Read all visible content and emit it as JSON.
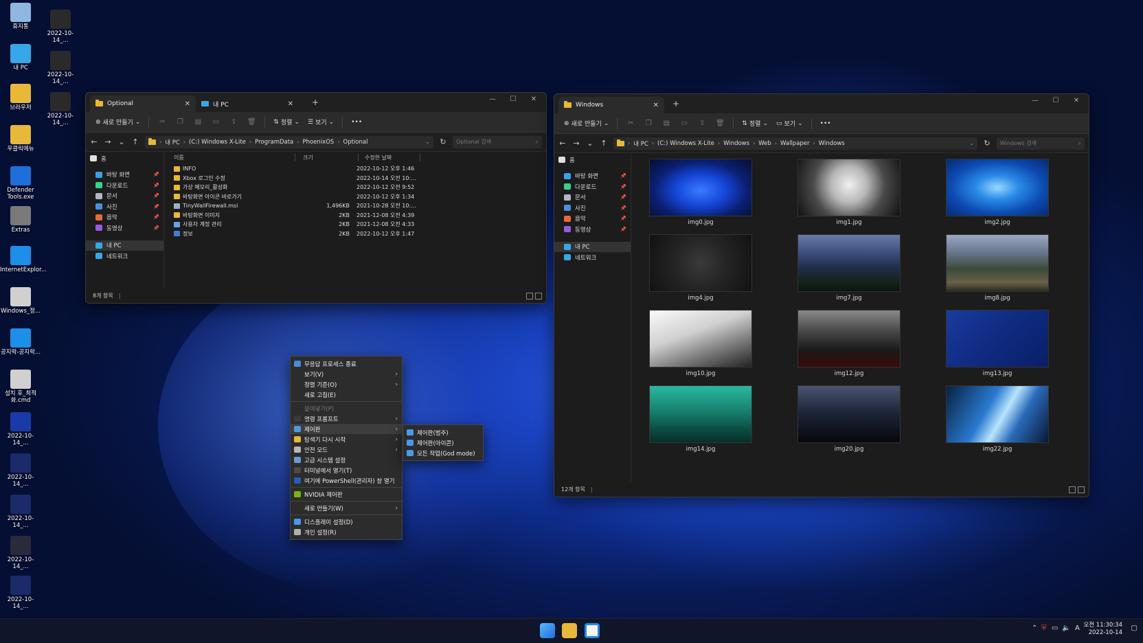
{
  "desktop": {
    "icons": [
      {
        "label": "휴지통",
        "icon": "recycle-bin-icon",
        "color": "#8fb7e0"
      },
      {
        "label": "2022-10-14_...",
        "icon": "screenshot-icon",
        "color": "#2a2a2a"
      },
      {
        "label": "내 PC",
        "icon": "pc-icon",
        "color": "#36a8e8"
      },
      {
        "label": "2022-10-14_...",
        "icon": "screenshot-icon",
        "color": "#2a2a2a"
      },
      {
        "label": "브라우저",
        "icon": "folder-icon",
        "color": "#e8b838"
      },
      {
        "label": "2022-10-14_...",
        "icon": "screenshot-icon",
        "color": "#2a2a2a"
      },
      {
        "label": "우클릭메뉴",
        "icon": "folder-icon",
        "color": "#e8b838"
      },
      {
        "label": "Defender Tools.exe",
        "icon": "shield-icon",
        "color": "#1e6fd9"
      },
      {
        "label": "Extras",
        "icon": "archive-icon",
        "color": "#7a7a7a"
      },
      {
        "label": "InternetExplor...",
        "icon": "ie-icon",
        "color": "#1e8fe8"
      },
      {
        "label": "Windows_정...",
        "icon": "cmd-gear-icon",
        "color": "#d0d0d0"
      },
      {
        "label": "공지락-공지락...",
        "icon": "ie-icon",
        "color": "#1e8fe8"
      },
      {
        "label": "설치 후_최적화.cmd",
        "icon": "cmd-gear-icon",
        "color": "#d0d0d0"
      },
      {
        "label": "2022-10-14_...",
        "icon": "screenshot-icon",
        "color": "#1a3aa8"
      },
      {
        "label": "2022-10-14_...",
        "icon": "screenshot-icon",
        "color": "#1a2a6a"
      },
      {
        "label": "2022-10-14_...",
        "icon": "screenshot-icon",
        "color": "#1a2a6a"
      },
      {
        "label": "2022-10-14_...",
        "icon": "screenshot-icon",
        "color": "#2a2a3a"
      },
      {
        "label": "2022-10-14_...",
        "icon": "screenshot-icon",
        "color": "#1a2a6a"
      }
    ]
  },
  "win1": {
    "tabs": [
      {
        "label": "Optional"
      },
      {
        "label": "내 PC"
      }
    ],
    "toolbar": {
      "new": "새로 만들기",
      "sort": "정렬",
      "view": "보기"
    },
    "address": [
      "내 PC",
      "(C:) Windows X-Lite",
      "ProgramData",
      "PhoenixOS",
      "Optional"
    ],
    "search_placeholder": "Optional 검색",
    "sidebar": [
      {
        "label": "홈",
        "color": "#e0e0e0"
      },
      {
        "label": "바탕 화면",
        "color": "#3aa0e8",
        "pin": true
      },
      {
        "label": "다운로드",
        "color": "#3ad08a",
        "pin": true
      },
      {
        "label": "문서",
        "color": "#b0b8c8",
        "pin": true
      },
      {
        "label": "사진",
        "color": "#4a90e2",
        "pin": true
      },
      {
        "label": "음악",
        "color": "#e86a3a",
        "pin": true
      },
      {
        "label": "동영상",
        "color": "#9a5ae0",
        "pin": true
      },
      {
        "label": "내 PC",
        "color": "#36a8e8"
      },
      {
        "label": "네트워크",
        "color": "#36a8e8"
      }
    ],
    "columns": {
      "name": "이름",
      "size": "크기",
      "date": "수정한 날짜"
    },
    "files": [
      {
        "name": "INFO",
        "size": "",
        "date": "2022-10-12 오후 1:46",
        "color": "#e8b838"
      },
      {
        "name": "Xbox 로그인 수정",
        "size": "",
        "date": "2022-10-14 오전 10:...",
        "color": "#e8b838"
      },
      {
        "name": "가상 메모리_활성화",
        "size": "",
        "date": "2022-10-12 오전 9:52",
        "color": "#e8b838"
      },
      {
        "name": "바탕화면 아이콘 바로가기",
        "size": "",
        "date": "2022-10-12 오후 1:34",
        "color": "#e8b838"
      },
      {
        "name": "TinyWallFirewall.msi",
        "size": "1,496KB",
        "date": "2021-10-28 오전 10:...",
        "color": "#9fb0c0"
      },
      {
        "name": "바탕화면 이미지",
        "size": "2KB",
        "date": "2021-12-08 오전 4:39",
        "color": "#e8b838"
      },
      {
        "name": "사용자 계정 관리",
        "size": "2KB",
        "date": "2021-12-08 오전 4:33",
        "color": "#6fa0e0"
      },
      {
        "name": "정보",
        "size": "2KB",
        "date": "2022-10-12 오후 1:47",
        "color": "#4a7ad0"
      }
    ],
    "status": "8개 항목"
  },
  "win2": {
    "tabs": [
      {
        "label": "Windows"
      }
    ],
    "toolbar": {
      "new": "새로 만들기",
      "sort": "정렬",
      "view": "보기"
    },
    "address": [
      "내 PC",
      "(C:) Windows X-Lite",
      "Windows",
      "Web",
      "Wallpaper",
      "Windows"
    ],
    "search_placeholder": "Windows 검색",
    "sidebar": [
      {
        "label": "홈",
        "color": "#e0e0e0"
      },
      {
        "label": "바탕 화면",
        "color": "#3aa0e8",
        "pin": true
      },
      {
        "label": "다운로드",
        "color": "#3ad08a",
        "pin": true
      },
      {
        "label": "문서",
        "color": "#b0b8c8",
        "pin": true
      },
      {
        "label": "사진",
        "color": "#4a90e2",
        "pin": true
      },
      {
        "label": "음악",
        "color": "#e86a3a",
        "pin": true
      },
      {
        "label": "동영상",
        "color": "#9a5ae0",
        "pin": true
      },
      {
        "label": "내 PC",
        "color": "#36a8e8"
      },
      {
        "label": "네트워크",
        "color": "#36a8e8"
      }
    ],
    "images": [
      {
        "name": "img0.jpg",
        "bg": "radial-gradient(ellipse at 50% 55%,#3a7cff 0%,#1546d8 35%,#0a1f70 65%,#060e30 100%)"
      },
      {
        "name": "img1.jpg",
        "bg": "radial-gradient(circle at 50% 45%,#f0f0f0 0%,#b8b8b8 30%,#4a4a4a 60%,#111 100%)"
      },
      {
        "name": "img2.jpg",
        "bg": "radial-gradient(ellipse at 50% 50%,#9ad8ff 0%,#2a8ae8 30%,#0c4ab0 65%,#062a70 100%)"
      },
      {
        "name": "img4.jpg",
        "bg": "radial-gradient(circle at 50% 50%,#3a3a3a 0%,#242424 45%,#121212 100%)"
      },
      {
        "name": "img7.jpg",
        "bg": "linear-gradient(180deg,#6a7aa8 0%,#3a4a78 35%,#1e2c48 60%,#142218 85%,#0c1410 100%)"
      },
      {
        "name": "img8.jpg",
        "bg": "linear-gradient(180deg,#9aa8c0 0%,#6a7890 30%,#3a4a38 60%,#6a6048 85%,#2a2a20 100%)"
      },
      {
        "name": "img10.jpg",
        "bg": "linear-gradient(160deg,#fafafa 0%,#d0d0d0 40%,#777 70%,#222 100%)"
      },
      {
        "name": "img12.jpg",
        "bg": "linear-gradient(180deg,#8a8a8a 0%,#4a4a4a 35%,#1a1a1a 70%,#3a0a0a 100%)"
      },
      {
        "name": "img13.jpg",
        "bg": "linear-gradient(135deg,#1a3aa0 0%,#0f2a80 50%,#0a1f68 100%)"
      },
      {
        "name": "img14.jpg",
        "bg": "linear-gradient(180deg,#2ab8a0 0%,#16806e 45%,#0c5046 75%,#063028 100%)"
      },
      {
        "name": "img20.jpg",
        "bg": "linear-gradient(180deg,#4a5570 0%,#1e2638 45%,#0e121c 80%,#06080c 100%)"
      },
      {
        "name": "img22.jpg",
        "bg": "linear-gradient(120deg,#082040 0%,#2a7ad0 40%,#b8e4ff 55%,#2a6ab8 70%,#081838 100%)"
      }
    ],
    "status": "12개 항목"
  },
  "context_menu": {
    "items": [
      {
        "label": "무응답 프로세스 종료",
        "icon": "#4a8ad8"
      },
      {
        "label": "보기(V)",
        "arrow": true
      },
      {
        "label": "정렬 기준(O)",
        "arrow": true
      },
      {
        "label": "새로 고침(E)"
      },
      {
        "sep": true
      },
      {
        "label": "붙여넣기(P)",
        "disabled": true
      },
      {
        "label": "명령 프롬프트",
        "icon": "#3a3a3a",
        "arrow": true
      },
      {
        "label": "제어판",
        "icon": "#4a9ae8",
        "arrow": true,
        "highlight": true
      },
      {
        "label": "탐색기 다시 시작",
        "icon": "#e8b838",
        "arrow": true
      },
      {
        "label": "안전 모드",
        "icon": "#b8b8b8",
        "arrow": true
      },
      {
        "label": "고급 시스템 설정",
        "icon": "#6a9ad8"
      },
      {
        "label": "터미널에서 열기(T)",
        "icon": "#4a4a4a"
      },
      {
        "label": "여기에 PowerShell(관리자) 창 열기",
        "icon": "#2a5ab8"
      },
      {
        "sep": true
      },
      {
        "label": "NVIDIA 제어판",
        "icon": "#76b900"
      },
      {
        "sep": true
      },
      {
        "label": "새로 만들기(W)",
        "arrow": true
      },
      {
        "sep": true
      },
      {
        "label": "디스플레이 설정(D)",
        "icon": "#4a9ae8"
      },
      {
        "label": "개인 설정(R)",
        "icon": "#b0b0b0"
      }
    ],
    "submenu": [
      {
        "label": "제어판(범주)",
        "icon": "#4a9ae8"
      },
      {
        "label": "제어판(아이콘)",
        "icon": "#4a9ae8"
      },
      {
        "label": "모든 작업(God mode)",
        "icon": "#4a9ae8"
      }
    ]
  },
  "taskbar": {
    "time": "오전 11:30:34",
    "date": "2022-10-14",
    "ime": "A"
  }
}
